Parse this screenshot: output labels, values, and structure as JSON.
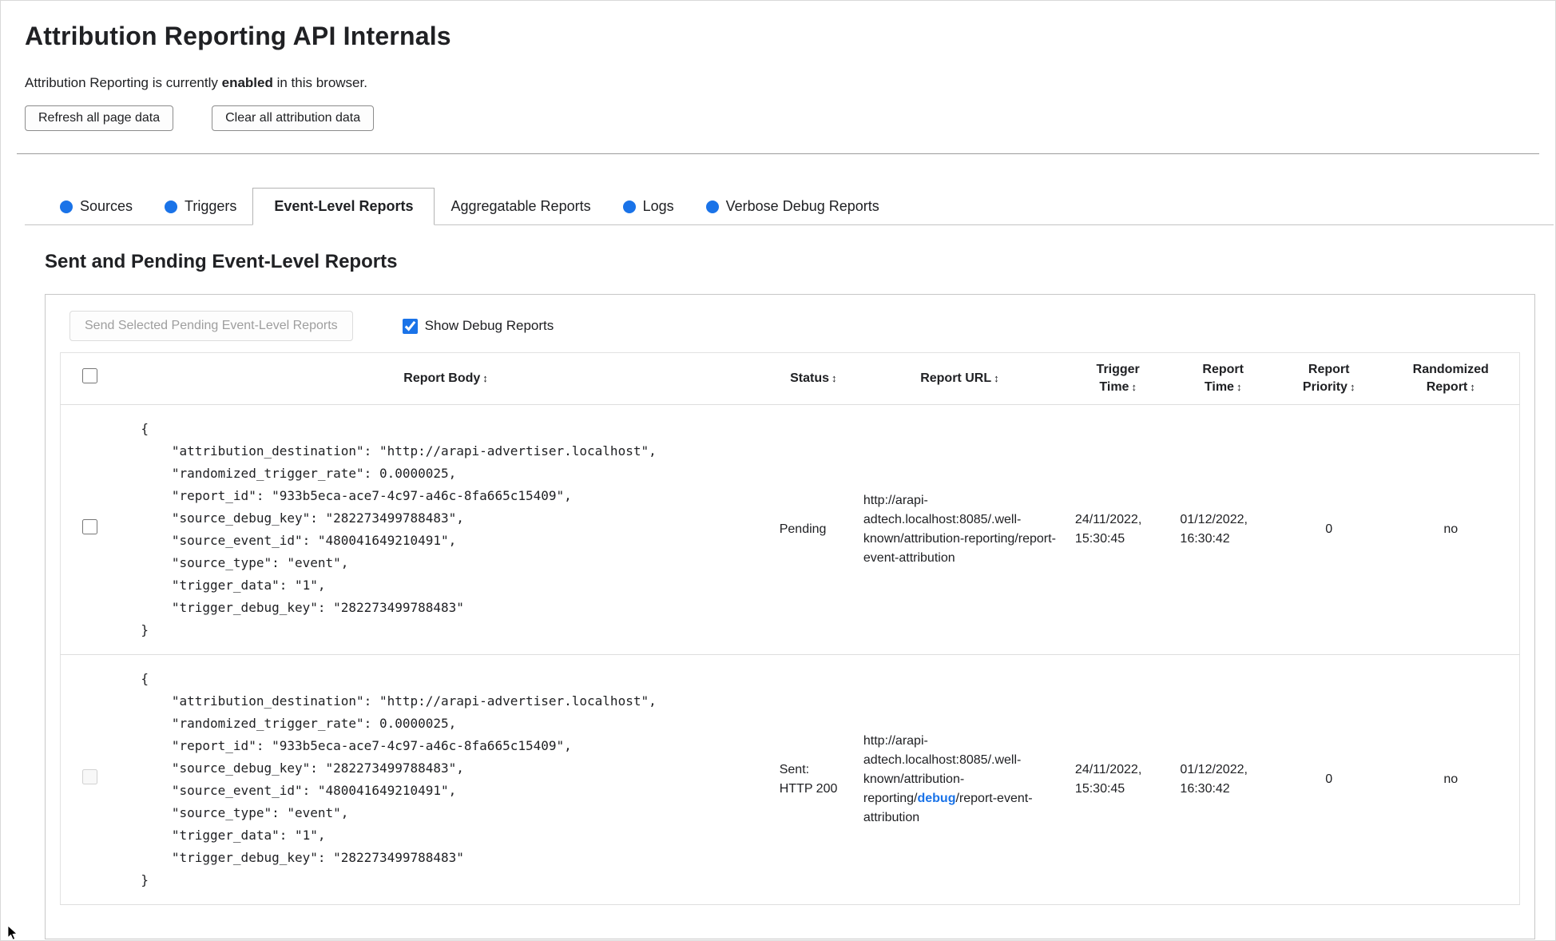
{
  "header": {
    "title": "Attribution Reporting API Internals",
    "status_prefix": "Attribution Reporting is currently ",
    "status_bold": "enabled",
    "status_suffix": " in this browser.",
    "refresh_button": "Refresh all page data",
    "clear_button": "Clear all attribution data"
  },
  "tabs": [
    {
      "label": "Sources",
      "has_dot": true,
      "active": false
    },
    {
      "label": "Triggers",
      "has_dot": true,
      "active": false
    },
    {
      "label": "Event-Level Reports",
      "has_dot": false,
      "active": true
    },
    {
      "label": "Aggregatable Reports",
      "has_dot": false,
      "active": false
    },
    {
      "label": "Logs",
      "has_dot": true,
      "active": false
    },
    {
      "label": "Verbose Debug Reports",
      "has_dot": true,
      "active": false
    }
  ],
  "colors": {
    "accent_blue": "#1a73e8",
    "dot_blue": "#1a73e8"
  },
  "section": {
    "title": "Sent and Pending Event-Level Reports",
    "send_button": "Send Selected Pending Event-Level Reports",
    "send_button_disabled": true,
    "show_debug_label": "Show Debug Reports",
    "show_debug_checked": true
  },
  "table": {
    "sort_icon": "↕",
    "select_all_checked": false,
    "headers": [
      "Report Body",
      "Status",
      "Report URL",
      "Trigger Time",
      "Report Time",
      "Report Priority",
      "Randomized Report"
    ],
    "rows": [
      {
        "selected": false,
        "checkbox_disabled": false,
        "report_body": "{\n    \"attribution_destination\": \"http://arapi-advertiser.localhost\",\n    \"randomized_trigger_rate\": 0.0000025,\n    \"report_id\": \"933b5eca-ace7-4c97-a46c-8fa665c15409\",\n    \"source_debug_key\": \"282273499788483\",\n    \"source_event_id\": \"480041649210491\",\n    \"source_type\": \"event\",\n    \"trigger_data\": \"1\",\n    \"trigger_debug_key\": \"282273499788483\"\n}",
        "status": "Pending",
        "url": "http://arapi-adtech.localhost:8085/.well-known/attribution-reporting/report-event-attribution",
        "trigger_time": "24/11/2022, 15:30:45",
        "report_time": "01/12/2022, 16:30:42",
        "report_priority": "0",
        "randomized_report": "no"
      },
      {
        "selected": false,
        "checkbox_disabled": true,
        "report_body": "{\n    \"attribution_destination\": \"http://arapi-advertiser.localhost\",\n    \"randomized_trigger_rate\": 0.0000025,\n    \"report_id\": \"933b5eca-ace7-4c97-a46c-8fa665c15409\",\n    \"source_debug_key\": \"282273499788483\",\n    \"source_event_id\": \"480041649210491\",\n    \"source_type\": \"event\",\n    \"trigger_data\": \"1\",\n    \"trigger_debug_key\": \"282273499788483\"\n}",
        "status": "Sent: HTTP 200",
        "url_prefix": "http://arapi-adtech.localhost:8085/.well-known/attribution-reporting/",
        "url_highlight": "debug",
        "url_suffix": "/report-event-attribution",
        "trigger_time": "24/11/2022, 15:30:45",
        "report_time": "01/12/2022, 16:30:42",
        "report_priority": "0",
        "randomized_report": "no"
      }
    ]
  }
}
